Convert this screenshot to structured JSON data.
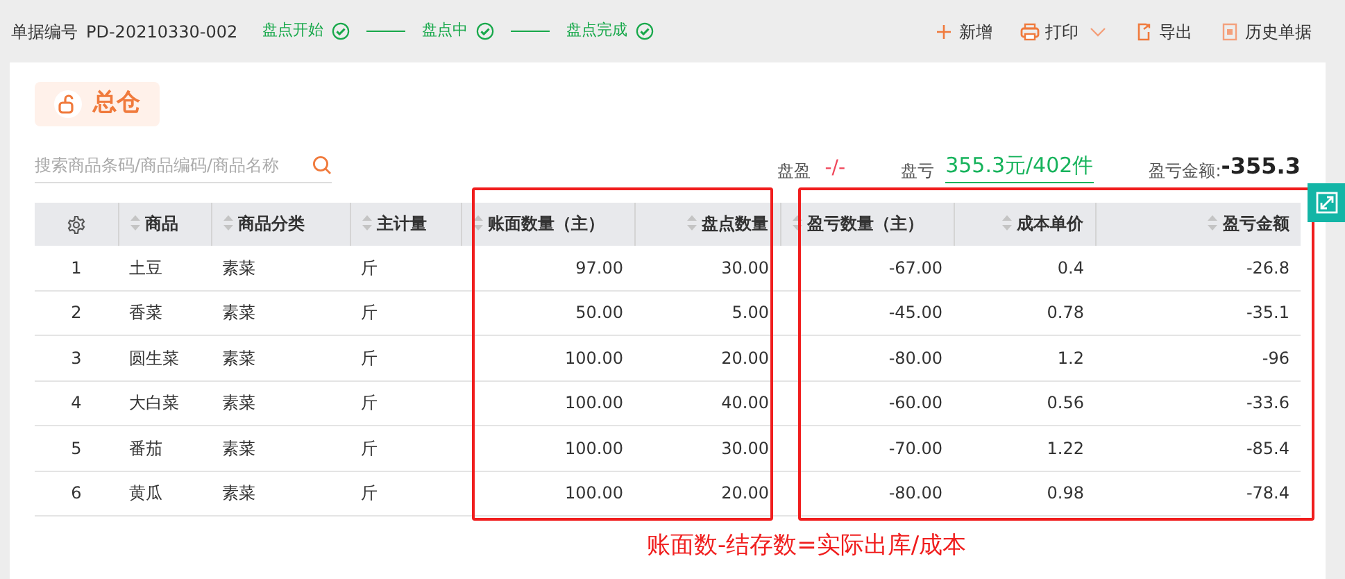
{
  "header": {
    "doc_label": "单据编号",
    "doc_number": "PD-20210330-002",
    "steps": [
      {
        "label": "盘点开始",
        "done": true
      },
      {
        "label": "盘点中",
        "done": true
      },
      {
        "label": "盘点完成",
        "done": true
      }
    ],
    "actions": [
      {
        "kind": "add",
        "label": "新增"
      },
      {
        "kind": "print",
        "label": "打印",
        "dropdown": true
      },
      {
        "kind": "export",
        "label": "导出"
      },
      {
        "kind": "history",
        "label": "历史单据"
      }
    ]
  },
  "warehouse": "总仓",
  "search": {
    "placeholder": "搜索商品条码/商品编码/商品名称"
  },
  "summary": {
    "gain_label": "盘盈",
    "gain_value": "-/-",
    "loss_label": "盘亏",
    "loss_value": "355.3元/402件",
    "amount_label": "盈亏金额:",
    "amount_value": "-355.3"
  },
  "table": {
    "columns": [
      {
        "label": "商品"
      },
      {
        "label": "商品分类"
      },
      {
        "label": "主计量"
      },
      {
        "label": "账面数量（主）"
      },
      {
        "label": "盘点数量"
      },
      {
        "label": "盈亏数量（主）"
      },
      {
        "label": "成本单价"
      },
      {
        "label": "盈亏金额"
      }
    ],
    "rows": [
      {
        "index": "1",
        "cells": [
          "土豆",
          "素菜",
          "斤",
          "97.00",
          "30.00",
          "-67.00",
          "0.4",
          "-26.8"
        ]
      },
      {
        "index": "2",
        "cells": [
          "香菜",
          "素菜",
          "斤",
          "50.00",
          "5.00",
          "-45.00",
          "0.78",
          "-35.1"
        ]
      },
      {
        "index": "3",
        "cells": [
          "圆生菜",
          "素菜",
          "斤",
          "100.00",
          "20.00",
          "-80.00",
          "1.2",
          "-96"
        ]
      },
      {
        "index": "4",
        "cells": [
          "大白菜",
          "素菜",
          "斤",
          "100.00",
          "40.00",
          "-60.00",
          "0.56",
          "-33.6"
        ]
      },
      {
        "index": "5",
        "cells": [
          "番茄",
          "素菜",
          "斤",
          "100.00",
          "30.00",
          "-70.00",
          "1.22",
          "-85.4"
        ]
      },
      {
        "index": "6",
        "cells": [
          "黄瓜",
          "素菜",
          "斤",
          "100.00",
          "20.00",
          "-80.00",
          "0.98",
          "-78.4"
        ]
      }
    ]
  },
  "annotation": {
    "note": "账面数-结存数=实际出库/成本"
  }
}
